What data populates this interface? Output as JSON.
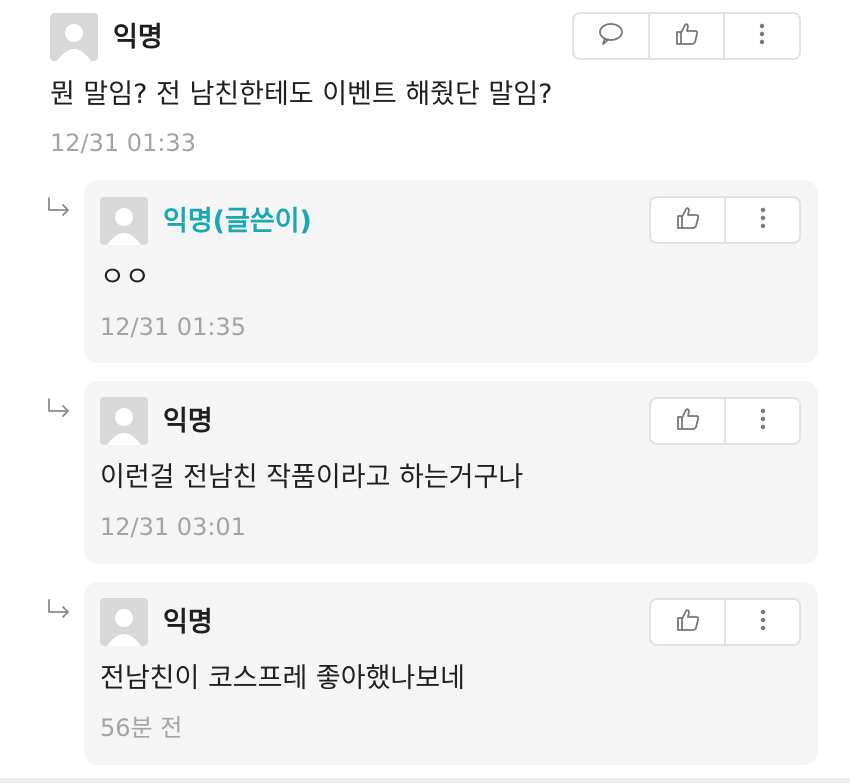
{
  "comment": {
    "author": "익명",
    "text": "뭔 말임? 전 남친한테도 이벤트 해줬단 말임?",
    "time": "12/31 01:33"
  },
  "replies": [
    {
      "author": "익명(글쓴이)",
      "text": "ㅇㅇ",
      "time": "12/31 01:35"
    },
    {
      "author": "익명",
      "text": "이런걸 전남친 작품이라고 하는거구나",
      "time": "12/31 03:01"
    },
    {
      "author": "익명",
      "text": "전남친이 코스프레 좋아했나보네",
      "time": "56분 전"
    }
  ],
  "icons": {
    "reply": "speech-bubble-icon",
    "like": "thumbs-up-icon",
    "more": "more-vertical-icon",
    "reply_arrow": "reply-arrow-icon",
    "avatar": "avatar-icon"
  },
  "colors": {
    "op_author": "#1aa9b4",
    "timestamp": "#a3a3a3",
    "reply_background": "#f5f5f5",
    "avatar": "#d8d8d8"
  }
}
